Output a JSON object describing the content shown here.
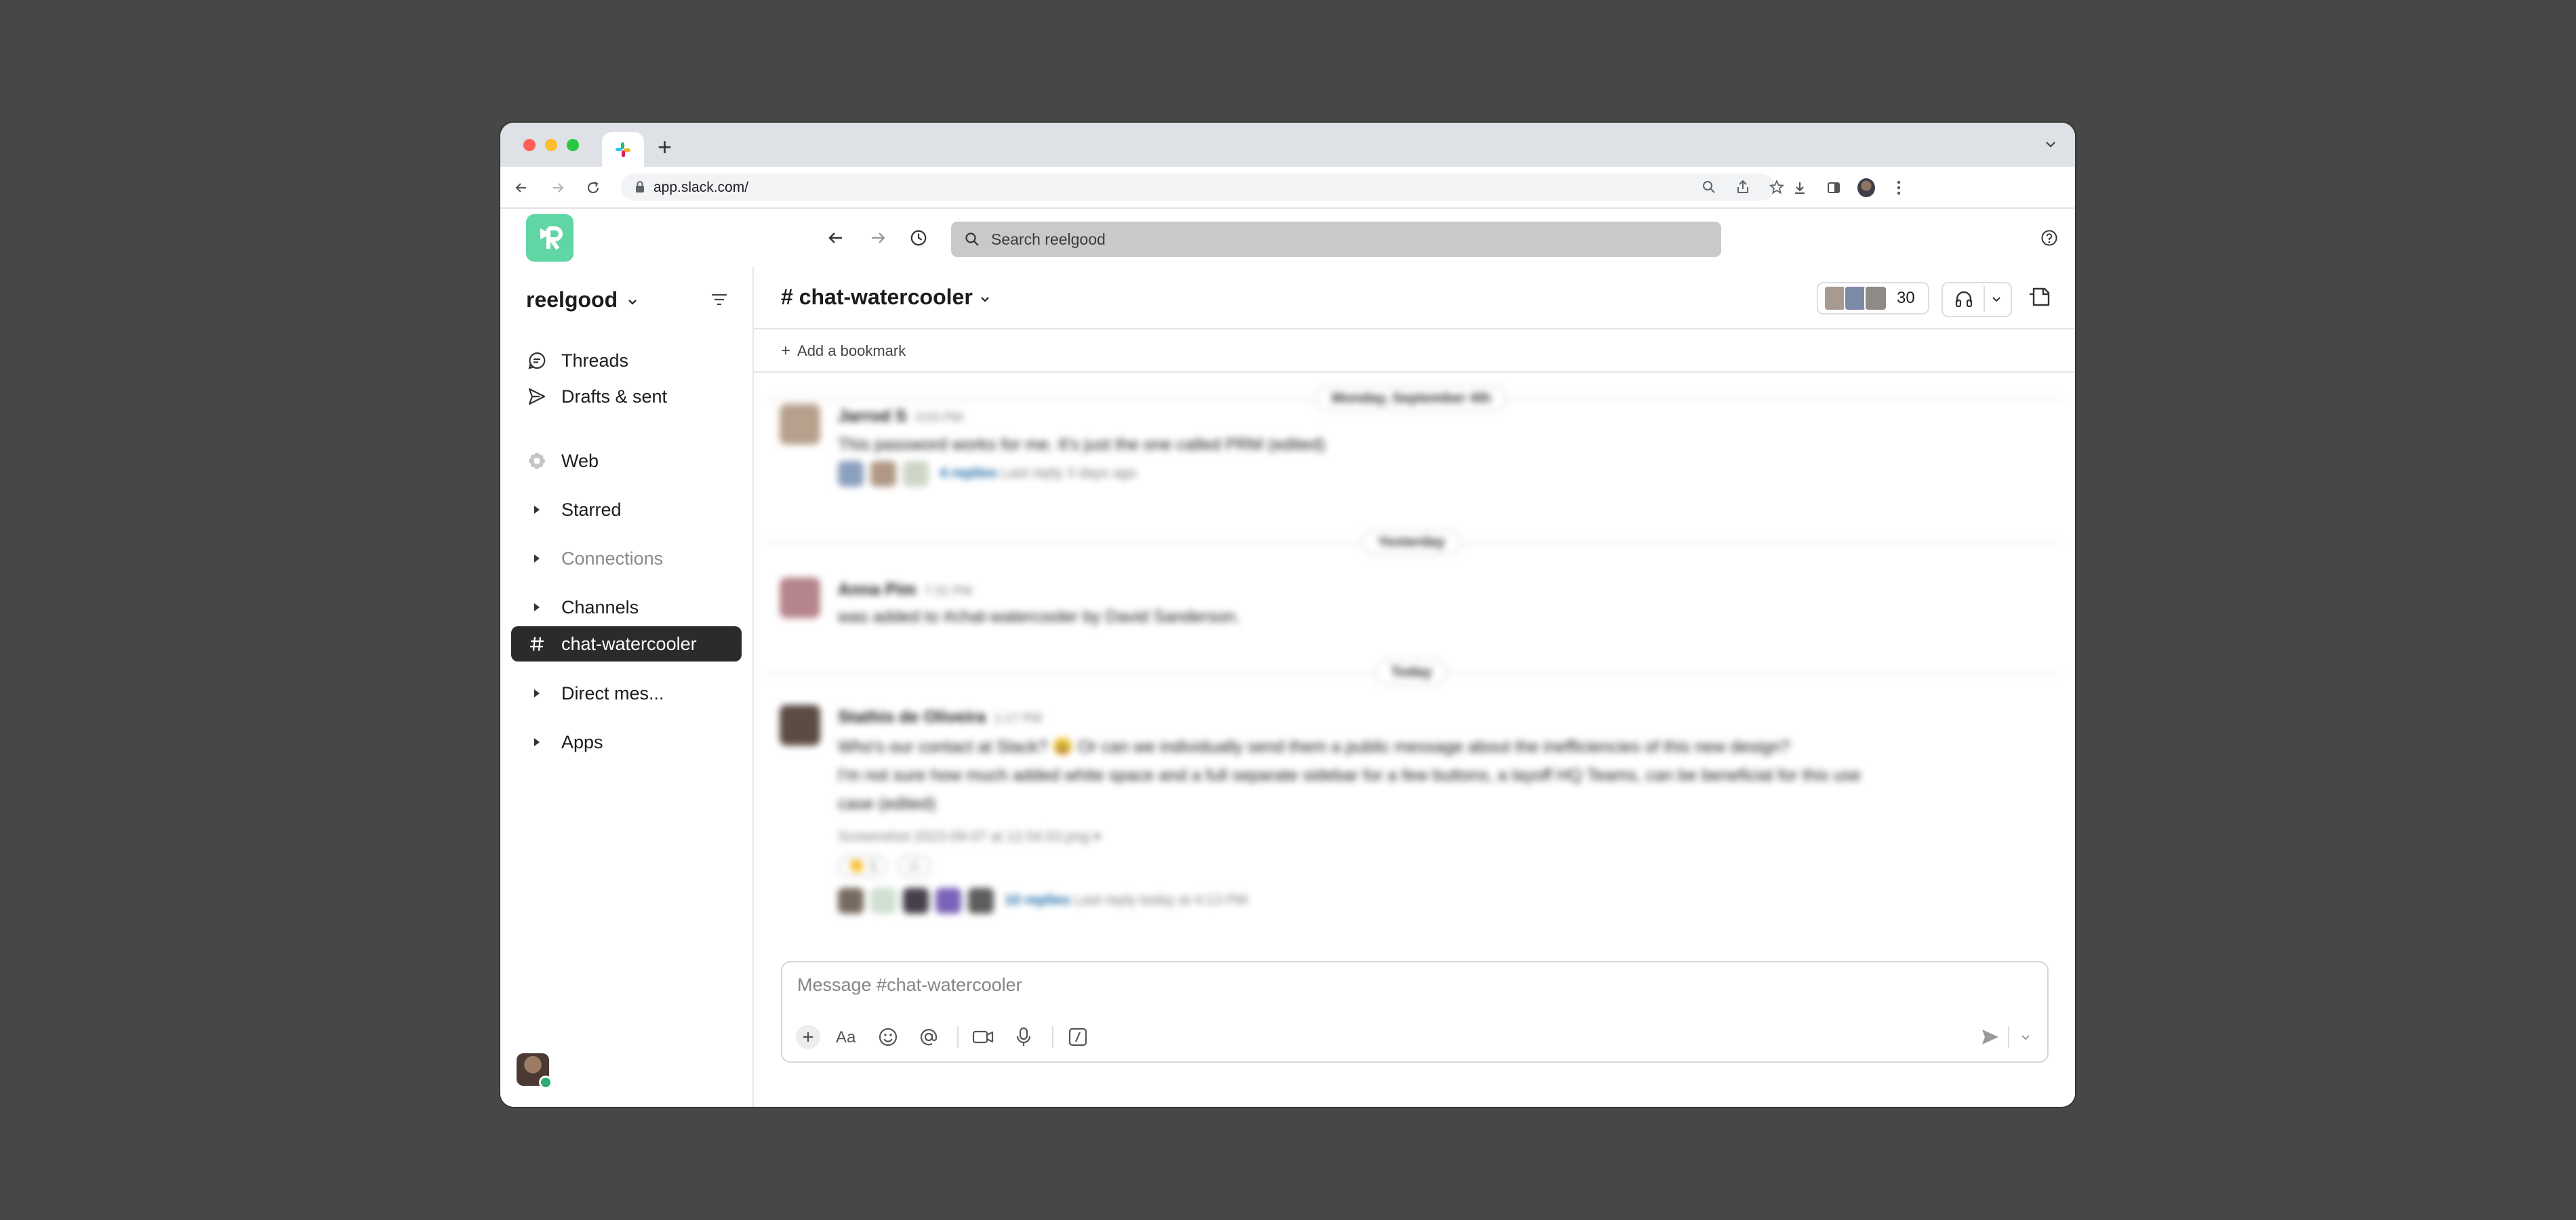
{
  "browser": {
    "url": "app.slack.com/",
    "traffic_lights": [
      "#ff5f57",
      "#febc2e",
      "#28c840"
    ],
    "new_tab_label": "+"
  },
  "topbar": {
    "search_placeholder": "Search reelgood"
  },
  "sidebar": {
    "workspace_name": "reelgood",
    "items": [
      {
        "label": "Threads",
        "icon": "threads-icon"
      },
      {
        "label": "Drafts & sent",
        "icon": "send-icon"
      },
      {
        "label": "Web",
        "icon": "web-icon"
      },
      {
        "label": "Starred",
        "icon": "caret-right-icon"
      },
      {
        "label": "Connections",
        "icon": "caret-right-icon"
      },
      {
        "label": "Channels",
        "icon": "caret-right-icon"
      },
      {
        "label": "chat-watercooler",
        "icon": "hash-icon",
        "active": true
      },
      {
        "label": "Direct mes...",
        "icon": "caret-right-icon"
      },
      {
        "label": "Apps",
        "icon": "caret-right-icon"
      }
    ]
  },
  "channel": {
    "name": "chat-watercooler",
    "hash": "#",
    "member_count": "30",
    "bookmark_label": "Add a bookmark"
  },
  "messages": {
    "day_1": "Monday, September 4th",
    "day_2": "Yesterday",
    "day_3": "Today",
    "m1": {
      "author": "Jarrod S",
      "time": "3:03 PM",
      "text": "This password works for me. It's just the one called PRM (edited)",
      "replies": "4 replies",
      "last_reply": "Last reply 3 days ago"
    },
    "m2": {
      "author": "Anna Pim",
      "time": "7:31 PM",
      "text": "was added to #chat-watercooler by David Sanderson."
    },
    "m3": {
      "author": "Stathis de Oliveira",
      "time": "1:17 PM",
      "text_1": "Who's our contact at Slack? 😃 Or can we individually send them a public message about the inefficiencies of this new design?",
      "text_2": "I'm not sure how much added white space and a full separate sidebar for a few buttons, a layoff HQ Teams, can be beneficial for this use",
      "text_3": "case (edited)",
      "attachment": "Screenshot 2023-09-07 at 12.54.53.png ▾",
      "reaction_1": "👏 1",
      "reaction_2": "☺",
      "replies": "10 replies",
      "last_reply": "Last reply today at 4:13 PM"
    }
  },
  "composer": {
    "placeholder": "Message #chat-watercooler"
  },
  "colors": {
    "accent_logo": "#5fd6a4",
    "active_item": "#2b2b2b",
    "presence": "#2bac76",
    "link": "#1264a3"
  }
}
